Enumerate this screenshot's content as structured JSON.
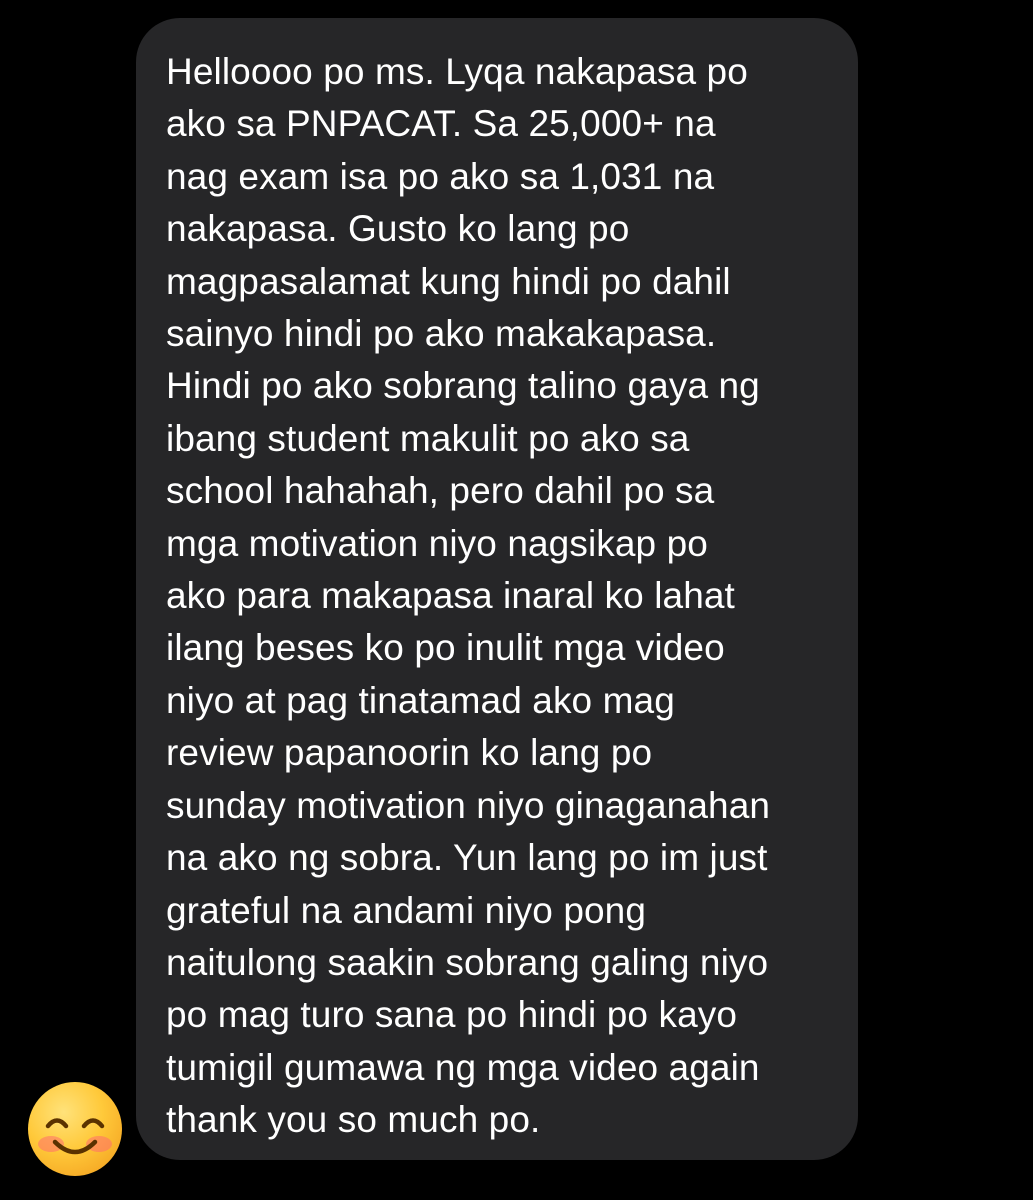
{
  "conversation": {
    "sender_avatar_icon": "smiling-face-with-smiling-eyes-icon",
    "message": {
      "lines": [
        "Helloooo po ms. Lyqa nakapasa po",
        "ako sa PNPACAT. Sa 25,000+ na",
        "nag exam isa po ako sa 1,031 na",
        "nakapasa. Gusto ko lang po",
        "magpasalamat kung hindi po dahil",
        "sainyo hindi po ako makakapasa.",
        "Hindi po ako sobrang talino gaya ng",
        "ibang student makulit po ako sa",
        "school hahahah, pero dahil po sa",
        "mga motivation niyo nagsikap po",
        "ako para makapasa inaral ko lahat",
        "ilang beses ko po inulit mga video",
        "niyo at pag tinatamad ako mag",
        "review papanoorin ko lang po",
        "sunday motivation niyo ginaganahan",
        "na ako ng sobra. Yun lang po im just",
        "grateful na andami niyo pong",
        "naitulong saakin sobrang galing niyo",
        "po mag turo sana po hindi po kayo",
        "tumigil gumawa ng mga video again",
        "thank you so much po."
      ]
    }
  },
  "colors": {
    "background": "#000000",
    "bubble": "#262628",
    "text": "#ffffff"
  }
}
